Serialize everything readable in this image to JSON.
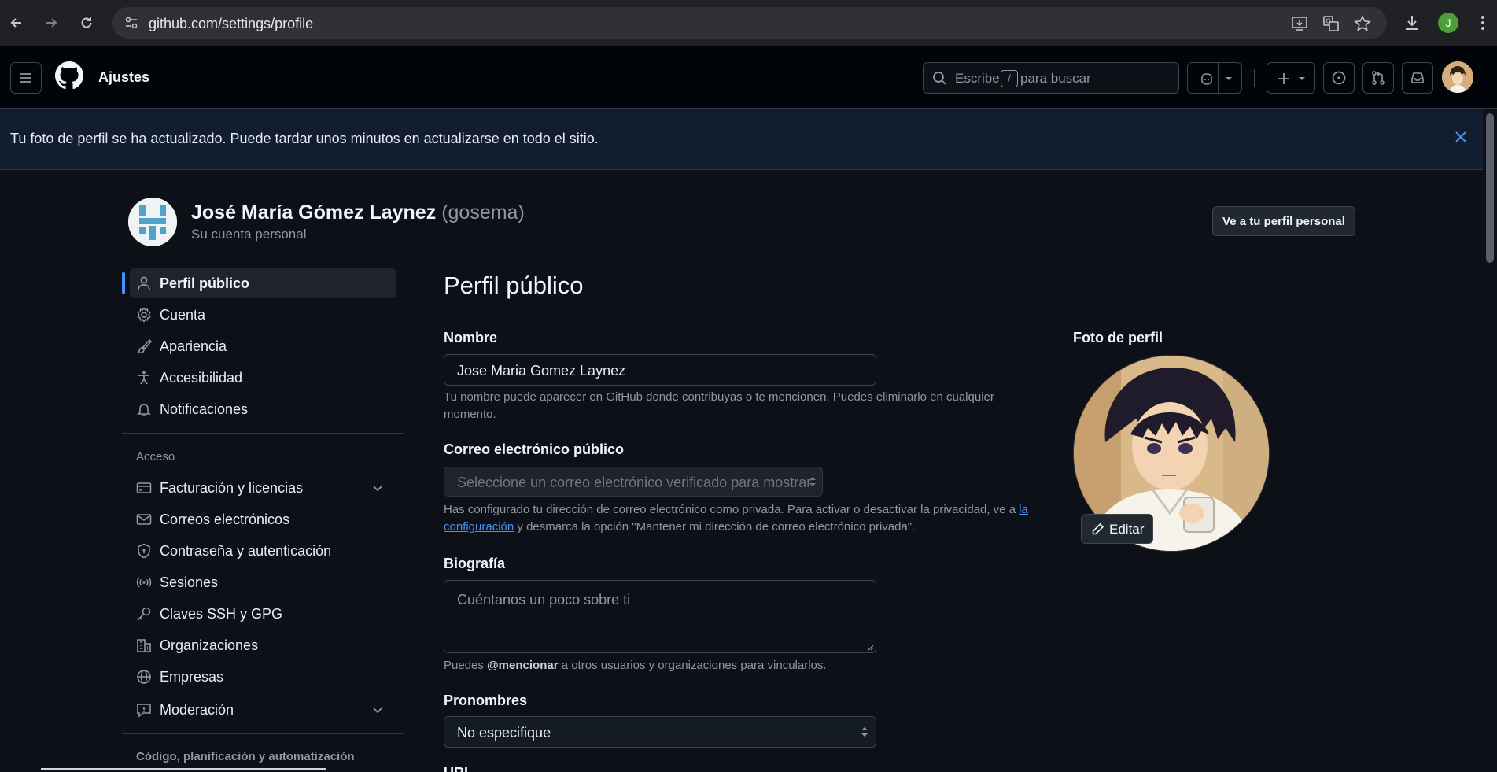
{
  "browser": {
    "url": "github.com/settings/profile",
    "profile_initial": "J"
  },
  "header": {
    "title": "Ajustes",
    "search_prefix": "Escribe",
    "search_key": "/",
    "search_suffix": "para buscar"
  },
  "flash": {
    "message": "Tu foto de perfil se ha actualizado. Puede tardar unos minutos en actualizarse en todo el sitio."
  },
  "account": {
    "name": "José María Gómez Laynez",
    "login": "(gosema)",
    "subtitle": "Su cuenta personal",
    "personal_profile_button": "Ve a tu perfil personal"
  },
  "sidebar": {
    "items": [
      {
        "label": "Perfil público",
        "icon": "person-icon"
      },
      {
        "label": "Cuenta",
        "icon": "gear-icon"
      },
      {
        "label": "Apariencia",
        "icon": "paintbrush-icon"
      },
      {
        "label": "Accesibilidad",
        "icon": "accessibility-icon"
      },
      {
        "label": "Notificaciones",
        "icon": "bell-icon"
      }
    ],
    "access_heading": "Acceso",
    "access_items": [
      {
        "label": "Facturación y licencias",
        "icon": "credit-card-icon"
      },
      {
        "label": "Correos electrónicos",
        "icon": "mail-icon"
      },
      {
        "label": "Contraseña y autenticación",
        "icon": "shield-lock-icon"
      },
      {
        "label": "Sesiones",
        "icon": "broadcast-icon"
      },
      {
        "label": "Claves SSH y GPG",
        "icon": "key-icon"
      },
      {
        "label": "Organizaciones",
        "icon": "organization-icon"
      },
      {
        "label": "Empresas",
        "icon": "globe-icon"
      },
      {
        "label": "Moderación",
        "icon": "report-icon"
      }
    ],
    "code_heading": "Código, planificación y automatización"
  },
  "main": {
    "title": "Perfil público",
    "name_label": "Nombre",
    "name_value": "Jose Maria Gomez Laynez",
    "name_note": "Tu nombre puede aparecer en GitHub donde contribuyas o te mencionen. Puedes eliminarlo en cualquier momento.",
    "email_label": "Correo electrónico público",
    "email_placeholder": "Seleccione un correo electrónico verificado para mostrar",
    "email_note_before": "Has configurado tu dirección de correo electrónico como privada. Para activar o desactivar la privacidad, ve a",
    "email_note_link": "la configuración",
    "email_note_after": "y desmarca la opción \"Mantener mi dirección de correo electrónico privada\".",
    "bio_label": "Biografía",
    "bio_placeholder": "Cuéntanos un poco sobre ti",
    "bio_note_before": "Puedes",
    "bio_note_mention": "@mencionar",
    "bio_note_after": "a otros usuarios y organizaciones para vincularlos.",
    "pronouns_label": "Pronombres",
    "pronouns_value": "No especifique",
    "url_label": "URL",
    "photo_label": "Foto de perfil",
    "photo_edit": "Editar"
  }
}
